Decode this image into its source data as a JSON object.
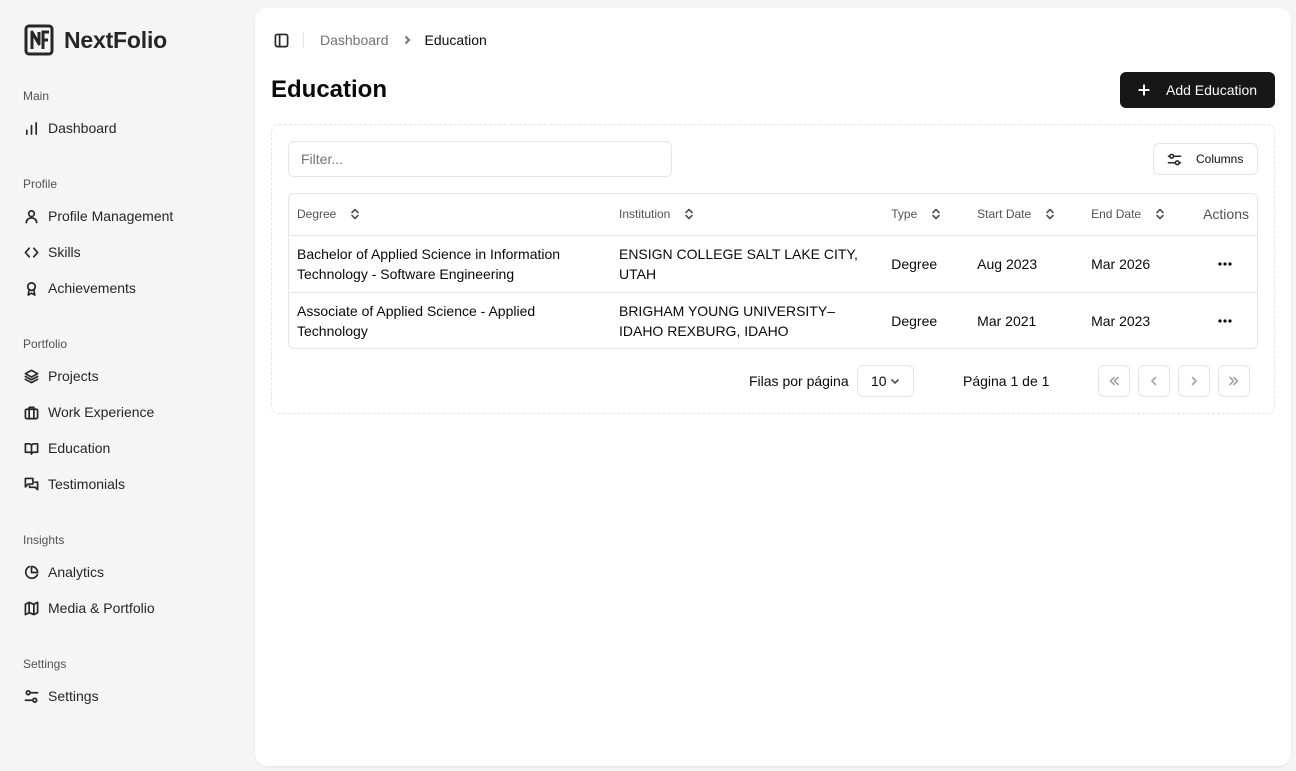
{
  "brand": {
    "name": "NextFolio"
  },
  "sidebar": {
    "groups": [
      {
        "label": "Main",
        "items": [
          {
            "label": "Dashboard",
            "icon": "bar-chart-icon"
          }
        ]
      },
      {
        "label": "Profile",
        "items": [
          {
            "label": "Profile Management",
            "icon": "user-icon"
          },
          {
            "label": "Skills",
            "icon": "code-icon"
          },
          {
            "label": "Achievements",
            "icon": "award-icon"
          }
        ]
      },
      {
        "label": "Portfolio",
        "items": [
          {
            "label": "Projects",
            "icon": "layers-icon"
          },
          {
            "label": "Work Experience",
            "icon": "briefcase-icon"
          },
          {
            "label": "Education",
            "icon": "book-open-icon"
          },
          {
            "label": "Testimonials",
            "icon": "messages-icon"
          }
        ]
      },
      {
        "label": "Insights",
        "items": [
          {
            "label": "Analytics",
            "icon": "pie-chart-icon"
          },
          {
            "label": "Media & Portfolio",
            "icon": "map-icon"
          }
        ]
      },
      {
        "label": "Settings",
        "items": [
          {
            "label": "Settings",
            "icon": "sliders-icon"
          }
        ]
      }
    ]
  },
  "breadcrumb": {
    "parent": "Dashboard",
    "current": "Education"
  },
  "page": {
    "title": "Education",
    "add_button": "Add Education"
  },
  "toolbar": {
    "filter_placeholder": "Filter...",
    "columns_button": "Columns"
  },
  "table": {
    "headers": [
      "Degree",
      "Institution",
      "Type",
      "Start Date",
      "End Date",
      "Actions"
    ],
    "rows": [
      {
        "degree": "Bachelor of Applied Science in Information Technology - Software Engineering",
        "institution": "ENSIGN COLLEGE SALT LAKE CITY, UTAH",
        "type": "Degree",
        "start": "Aug 2023",
        "end": "Mar 2026"
      },
      {
        "degree": "Associate of Applied Science - Applied Technology",
        "institution": "BRIGHAM YOUNG UNIVERSITY–IDAHO REXBURG, IDAHO",
        "type": "Degree",
        "start": "Mar 2021",
        "end": "Mar 2023"
      }
    ]
  },
  "pagination": {
    "rows_label": "Filas por página",
    "rows_value": "10",
    "page_info": "Página 1 de 1"
  }
}
